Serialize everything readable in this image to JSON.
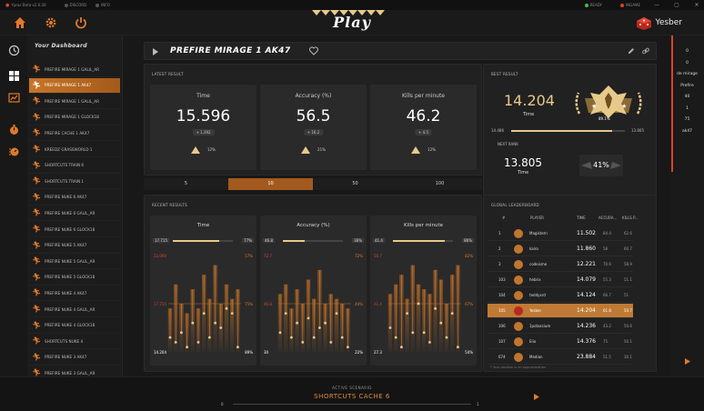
{
  "app": {
    "name": "Yprac Beta v2.0.30",
    "status_discord": "DISCORD",
    "status_info": "INFO",
    "ready": "READY",
    "ingame": "INGAME",
    "min": "—",
    "max": "▢",
    "close": "✕"
  },
  "header": {
    "title": "Play",
    "username": "Yesber"
  },
  "colors": {
    "accent": "#c87528",
    "gold": "#e7c98a",
    "bg": "#181818",
    "panel": "#212121",
    "card": "#2a2a2a",
    "red": "#d9442b",
    "green": "#35c24d"
  },
  "nav_icons": [
    "home-icon",
    "gear-icon",
    "power-icon",
    "history-icon",
    "dashboard-icon",
    "chart-icon",
    "stopwatch-icon",
    "timer-icon"
  ],
  "dashboard": {
    "heading": "Your Dashboard",
    "items": [
      {
        "label": "PREFIRE MIRAGE 1 GALIL_AR"
      },
      {
        "label": "PREFIRE MIRAGE 1 AK47",
        "active": true
      },
      {
        "label": "PREFIRE MIRAGE 1 GALIL_AR"
      },
      {
        "label": "PREFIRE MIRAGE 1 GLOCK18"
      },
      {
        "label": "PREFIRE CACHE 1 AK47"
      },
      {
        "label": "KREEDZ GRASSWORLD 1"
      },
      {
        "label": "SHORTCUTS TRAIN 6"
      },
      {
        "label": "SHORTCUTS TRAIN 1"
      },
      {
        "label": "PREFIRE NUKE 6 AK47"
      },
      {
        "label": "PREFIRE NUKE 6 GALIL_AR"
      },
      {
        "label": "PREFIRE NUKE 6 GLOCK18"
      },
      {
        "label": "PREFIRE NUKE 5 AK47"
      },
      {
        "label": "PREFIRE NUKE 5 GALIL_AR"
      },
      {
        "label": "PREFIRE NUKE 5 GLOCK18"
      },
      {
        "label": "PREFIRE NUKE 4 AK47"
      },
      {
        "label": "PREFIRE NUKE 4 GALIL_AR"
      },
      {
        "label": "PREFIRE NUKE 4 GLOCK18"
      },
      {
        "label": "SHORTCUTS NUKE 4"
      },
      {
        "label": "PREFIRE NUKE 3 AK47"
      },
      {
        "label": "PREFIRE NUKE 3 GALIL_AR"
      }
    ]
  },
  "scenario": {
    "name": "PREFIRE MIRAGE 1 AK47"
  },
  "latest": {
    "label": "LATEST RESULT",
    "cards": [
      {
        "label": "Time",
        "value": "15.596",
        "delta": "+ 1.392",
        "pct": "12%",
        "pct_value": 12
      },
      {
        "label": "Accuracy (%)",
        "value": "56.5",
        "delta": "+ 16.2",
        "pct": "21%",
        "pct_value": 21
      },
      {
        "label": "Kills per minute",
        "value": "46.2",
        "delta": "+ 4.5",
        "pct": "12%",
        "pct_value": 12
      }
    ]
  },
  "best": {
    "label": "BEST RESULT",
    "value": "14.204",
    "sub": "Time",
    "rank_pct": "89.1%",
    "progress_min": "14.486",
    "progress_max": "13.805",
    "progress_fill": 0.89,
    "next_label": "NEXT RANK",
    "next_value": "13.805",
    "next_sub": "Time",
    "next_pct": "41%"
  },
  "tabs": [
    "5",
    "10",
    "50",
    "100"
  ],
  "active_tab": 1,
  "recent": {
    "label": "RECENT RESULTS",
    "charts": [
      {
        "label": "Time",
        "bar_left": "17.715",
        "bar_right": "77%",
        "bar_fill": 0.77,
        "top": "22.099",
        "mid": "17.715",
        "bottom": "14.204",
        "r_top": "57%",
        "r_mid": "75%",
        "r_bottom": "89%"
      },
      {
        "label": "Accuracy (%)",
        "bar_left": "46.8",
        "bar_right": "36%",
        "bar_fill": 0.36,
        "top": "72.7",
        "mid": "46.8",
        "bottom": "30",
        "r_top": "72%",
        "r_mid": "44%",
        "r_bottom": "22%"
      },
      {
        "label": "Kills per minute",
        "bar_left": "41.4",
        "bar_right": "86%",
        "bar_fill": 0.86,
        "top": "50.7",
        "mid": "41.4",
        "bottom": "27.3",
        "r_top": "82%",
        "r_mid": "67%",
        "r_bottom": "54%"
      }
    ]
  },
  "leaderboard": {
    "label": "GLOBAL LEADERBOARD",
    "headers": [
      "#",
      "PLAYER",
      "TIME",
      "ACCURA...",
      "KILLS P..."
    ],
    "rows": [
      {
        "rank": "1",
        "player": "Magistern",
        "time": "11.502",
        "acc": "84.4",
        "kpm": "62.6"
      },
      {
        "rank": "2",
        "player": "kairo",
        "time": "11.860",
        "acc": "58",
        "kpm": "60.7"
      },
      {
        "rank": "3",
        "player": "codeisme",
        "time": "12.221",
        "acc": "70.6",
        "kpm": "58.9"
      },
      {
        "rank": "103",
        "player": "hebrix",
        "time": "14.079",
        "acc": "55.3",
        "kpm": "51.1"
      },
      {
        "rank": "104",
        "player": "teddyxrd",
        "time": "14.124",
        "acc": "66.7",
        "kpm": "51"
      },
      {
        "rank": "105",
        "player": "Yesber",
        "time": "14.204",
        "acc": "61.8",
        "kpm": "50.7",
        "me": true
      },
      {
        "rank": "106",
        "player": "1potassium",
        "time": "14.236",
        "acc": "43.2",
        "kpm": "50.6"
      },
      {
        "rank": "107",
        "player": "Elio",
        "time": "14.376",
        "acc": "75",
        "kpm": "50.1"
      },
      {
        "rank": "674",
        "player": "Median",
        "time": "23.884",
        "acc": "51.5",
        "kpm": "30.1"
      }
    ],
    "footnote": "* Your position is an approximation"
  },
  "right_sidebar": [
    "0",
    "0",
    "de mirage",
    "Prefire",
    "40",
    "1",
    "75",
    "ak47"
  ],
  "bottom": {
    "label": "ACTIVE SCENARIO",
    "name": "SHORTCUTS CACHE 6",
    "left": "0",
    "right": "1"
  }
}
